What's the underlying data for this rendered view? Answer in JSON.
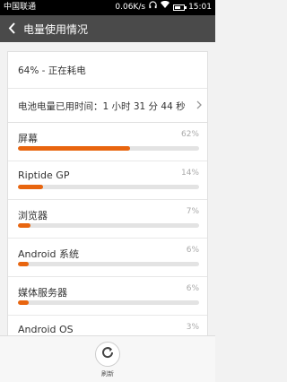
{
  "status_bar": {
    "carrier": "中国联通",
    "speed": "0.06K/s",
    "time": "15:01"
  },
  "header": {
    "title": "电量使用情况"
  },
  "summary": {
    "battery_status": "64% - 正在耗电",
    "usage_time": "电池电量已用时间：1 小时 31 分 44 秒"
  },
  "apps": [
    {
      "name": "屏幕",
      "percent_label": "62%",
      "percent": 62
    },
    {
      "name": "Riptide GP",
      "percent_label": "14%",
      "percent": 14
    },
    {
      "name": "浏览器",
      "percent_label": "7%",
      "percent": 7
    },
    {
      "name": "Android 系统",
      "percent_label": "6%",
      "percent": 6
    },
    {
      "name": "媒体服务器",
      "percent_label": "6%",
      "percent": 6
    },
    {
      "name": "Android OS",
      "percent_label": "3%",
      "percent": 3
    }
  ],
  "bottom": {
    "refresh_label": "刷新"
  },
  "colors": {
    "accent": "#e8650f",
    "title_bar": "#4a4a4a"
  },
  "icons": {
    "back": "chevron-left-icon",
    "refresh": "refresh-icon",
    "wifi": "wifi-icon",
    "headset": "headset-icon",
    "battery": "battery-icon"
  }
}
